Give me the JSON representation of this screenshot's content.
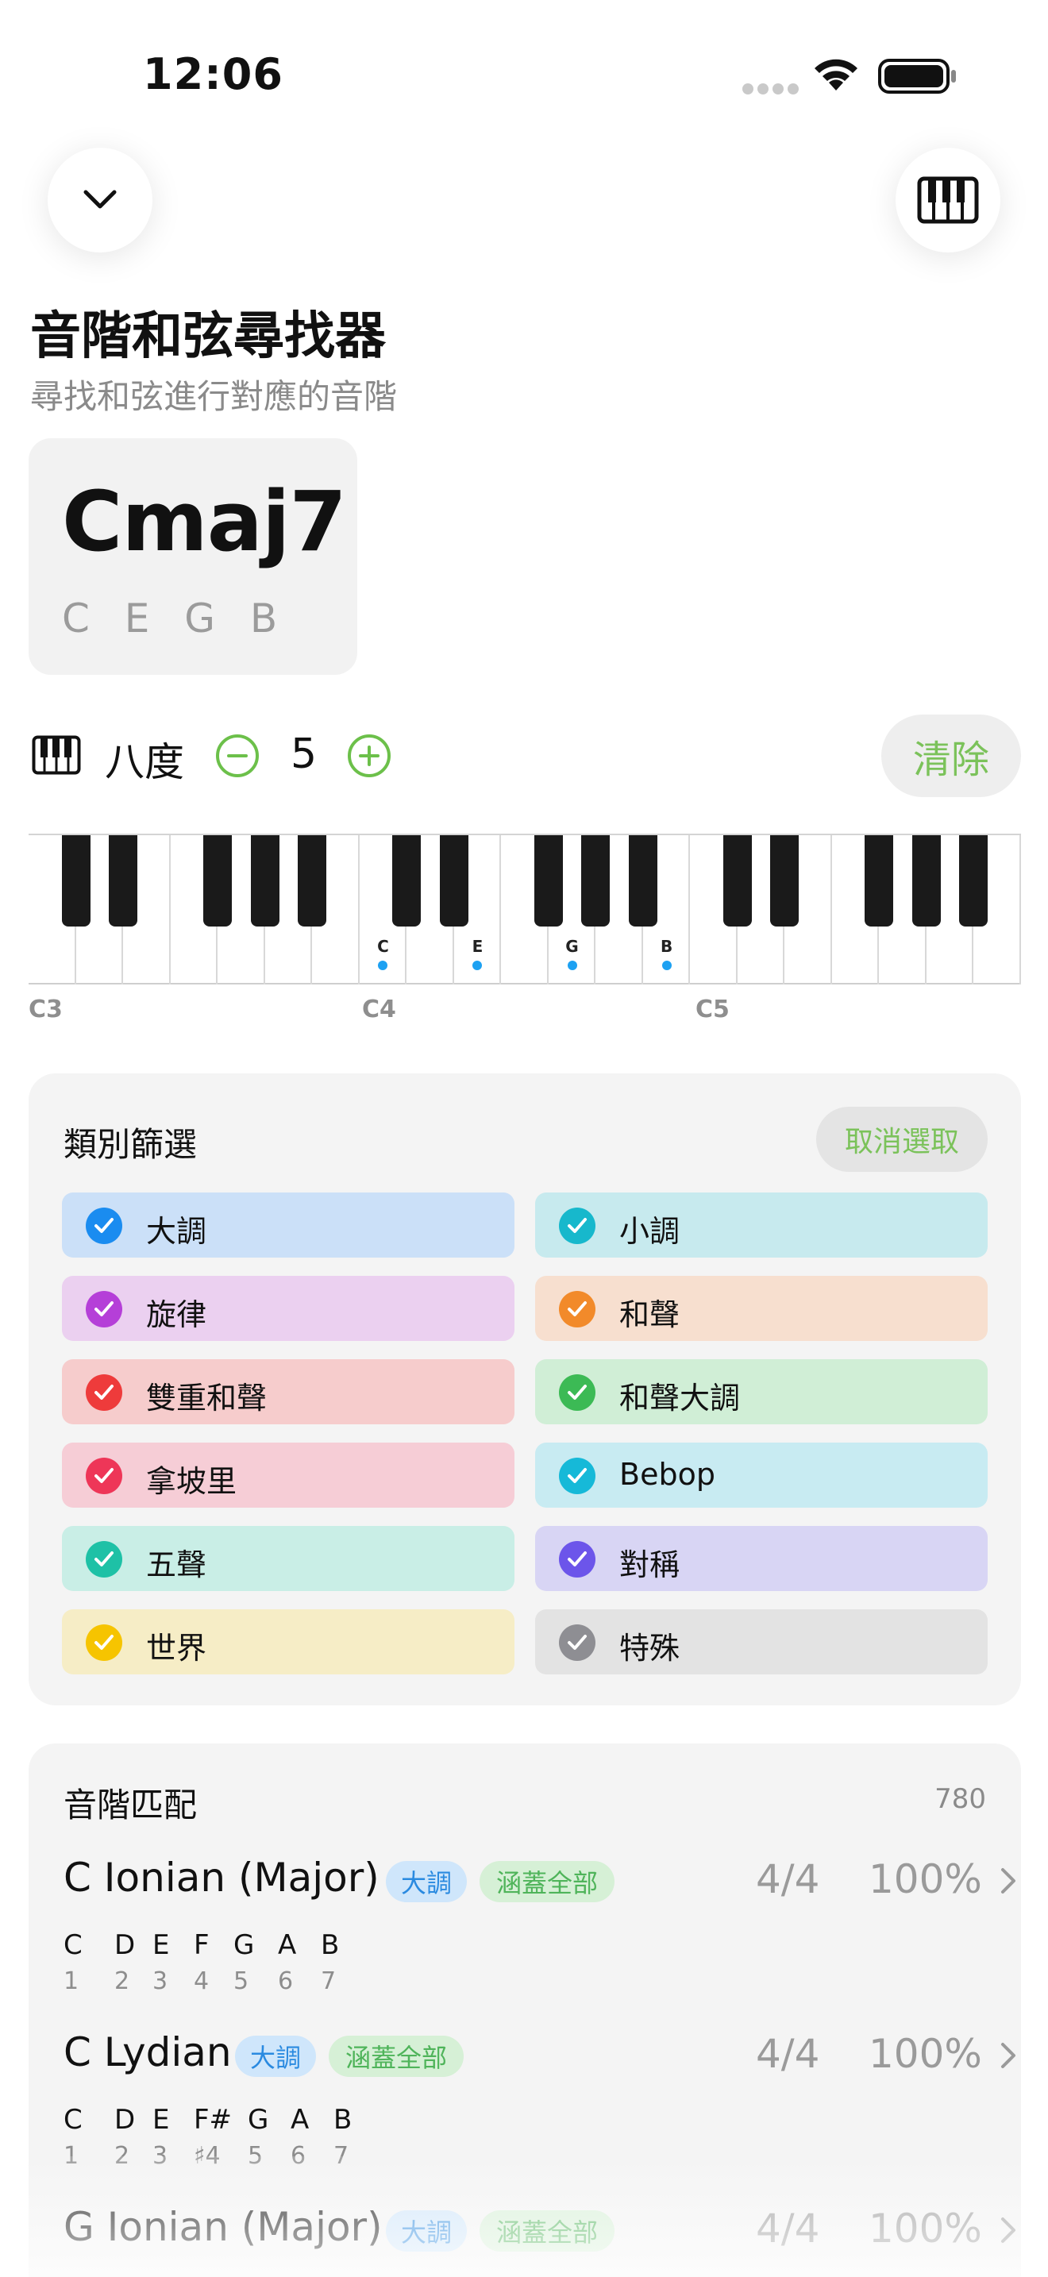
{
  "status_bar": {
    "time": "12:06"
  },
  "header": {
    "title": "音階和弦尋找器",
    "subtitle": "尋找和弦進行對應的音階"
  },
  "chord": {
    "name": "Cmaj7",
    "notes": "C E G B"
  },
  "octave": {
    "label": "八度",
    "value": "5",
    "clear_label": "清除"
  },
  "keyboard": {
    "octave_labels": [
      "C3",
      "C4",
      "C5"
    ],
    "marked_notes": [
      "C",
      "E",
      "G",
      "B"
    ],
    "dot_color": "#1da1f2"
  },
  "filter": {
    "title": "類別篩選",
    "deselect_label": "取消選取",
    "categories": [
      {
        "label": "大調",
        "color": "#1a8cf0",
        "bg": "#cbe0f8"
      },
      {
        "label": "小調",
        "color": "#17b8cc",
        "bg": "#c7eaee"
      },
      {
        "label": "旋律",
        "color": "#b53fd8",
        "bg": "#ebd0f0"
      },
      {
        "label": "和聲",
        "color": "#f28a2a",
        "bg": "#f7dfcf"
      },
      {
        "label": "雙重和聲",
        "color": "#ee3b3b",
        "bg": "#f6cccc"
      },
      {
        "label": "和聲大調",
        "color": "#3cba55",
        "bg": "#d0eed6"
      },
      {
        "label": "拿坡里",
        "color": "#ee3658",
        "bg": "#f6cdd6"
      },
      {
        "label": "Bebop",
        "color": "#16b9d8",
        "bg": "#c8ebf2"
      },
      {
        "label": "五聲",
        "color": "#1ec1a6",
        "bg": "#c9eee6"
      },
      {
        "label": "對稱",
        "color": "#6c55ea",
        "bg": "#d8d5f4"
      },
      {
        "label": "世界",
        "color": "#f6c400",
        "bg": "#f6edc6"
      },
      {
        "label": "特殊",
        "color": "#8e8e93",
        "bg": "#e3e3e3"
      }
    ]
  },
  "matches": {
    "title": "音階匹配",
    "count": "780",
    "scales": [
      {
        "name": "C Ionian (Major)",
        "badge_type": "大調",
        "badge_cover": "涵蓋全部",
        "ratio": "4/4",
        "percent": "100%",
        "notes": [
          "C",
          "D",
          "E",
          "F",
          "G",
          "A",
          "B"
        ],
        "degrees": [
          "1",
          "2",
          "3",
          "4",
          "5",
          "6",
          "7"
        ]
      },
      {
        "name": "C Lydian",
        "badge_type": "大調",
        "badge_cover": "涵蓋全部",
        "ratio": "4/4",
        "percent": "100%",
        "notes": [
          "C",
          "D",
          "E",
          "F#",
          "G",
          "A",
          "B"
        ],
        "degrees": [
          "1",
          "2",
          "3",
          "♯4",
          "5",
          "6",
          "7"
        ]
      },
      {
        "name": "G Ionian (Major)",
        "badge_type": "大調",
        "badge_cover": "涵蓋全部",
        "ratio": "4/4",
        "percent": "100%",
        "notes": [],
        "degrees": []
      }
    ]
  }
}
